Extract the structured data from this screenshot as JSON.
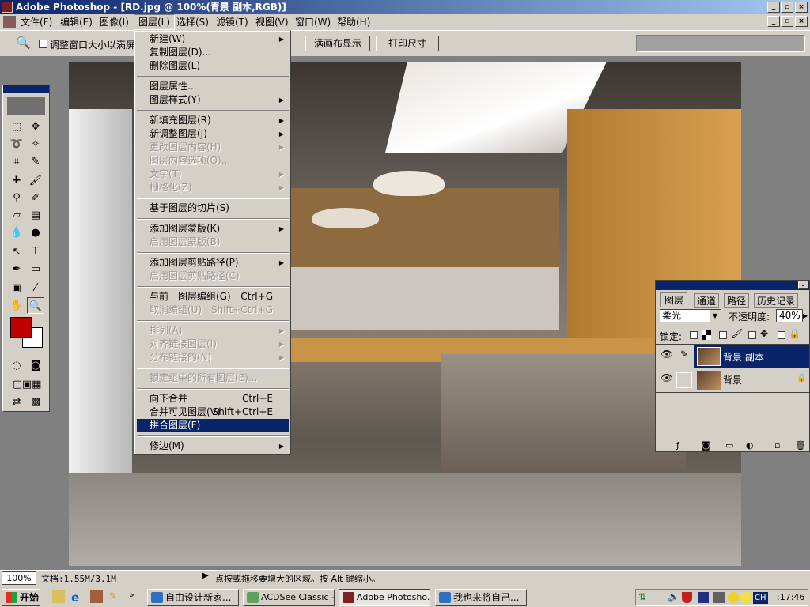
{
  "window": {
    "title": "Adobe Photoshop - [RD.jpg @ 100%(青景 副本,RGB)]"
  },
  "menubar": [
    "文件(F)",
    "编辑(E)",
    "图像(I)",
    "图层(L)",
    "选择(S)",
    "滤镜(T)",
    "视图(V)",
    "窗口(W)",
    "帮助(H)"
  ],
  "options": {
    "checkbox_label": "调整窗口大小以满屏",
    "fit_button": "满画布显示",
    "print_button": "打印尺寸"
  },
  "layer_menu": [
    {
      "label": "新建(W)",
      "sub": true
    },
    {
      "label": "复制图层(D)..."
    },
    {
      "label": "删除图层(L)"
    },
    {
      "sep": true
    },
    {
      "label": "图层属性..."
    },
    {
      "label": "图层样式(Y)",
      "sub": true
    },
    {
      "sep": true
    },
    {
      "label": "新填充图层(R)",
      "sub": true
    },
    {
      "label": "新调整图层(J)",
      "sub": true
    },
    {
      "label": "更改图层内容(H)",
      "sub": true,
      "disabled": true
    },
    {
      "label": "图层内容选项(O)...",
      "disabled": true
    },
    {
      "label": "文字(T)",
      "sub": true,
      "disabled": true
    },
    {
      "label": "栅格化(Z)",
      "sub": true,
      "disabled": true
    },
    {
      "sep": true
    },
    {
      "label": "基于图层的切片(S)"
    },
    {
      "sep": true
    },
    {
      "label": "添加图层蒙版(K)",
      "sub": true
    },
    {
      "label": "启用图层蒙版(B)",
      "disabled": true
    },
    {
      "sep": true
    },
    {
      "label": "添加图层剪贴路径(P)",
      "sub": true
    },
    {
      "label": "启用图层剪贴路径(C)",
      "disabled": true
    },
    {
      "sep": true
    },
    {
      "label": "与前一图层编组(G)",
      "shortcut": "Ctrl+G"
    },
    {
      "label": "取消编组(U)",
      "shortcut": "Shift+Ctrl+G",
      "disabled": true
    },
    {
      "sep": true
    },
    {
      "label": "排列(A)",
      "sub": true,
      "disabled": true
    },
    {
      "label": "对齐链接图层(I)",
      "sub": true,
      "disabled": true
    },
    {
      "label": "分布链接的(N)",
      "sub": true,
      "disabled": true
    },
    {
      "sep": true
    },
    {
      "label": "锁定组中的所有图层(E)...",
      "disabled": true
    },
    {
      "sep": true
    },
    {
      "label": "向下合并",
      "shortcut": "Ctrl+E"
    },
    {
      "label": "合并可见图层(V)",
      "shortcut": "Shift+Ctrl+E"
    },
    {
      "label": "拼合图层(F)",
      "selected": true
    },
    {
      "sep": true
    },
    {
      "label": "修边(M)",
      "sub": true
    }
  ],
  "layers_panel": {
    "tabs": [
      "图层",
      "通道",
      "路径",
      "历史记录"
    ],
    "blend_mode": "柔光",
    "opacity_label": "不透明度:",
    "opacity": "40%",
    "lock_label": "锁定:",
    "layers": [
      {
        "name": "背景 副本",
        "selected": true
      },
      {
        "name": "背景",
        "locked": true
      }
    ]
  },
  "status": {
    "zoom": "100%",
    "doc": "文档:1.55M/3.1M",
    "hint": "点按或拖移要增大的区域。按 Alt 键缩小。"
  },
  "taskbar": {
    "start": "开始",
    "tasks": [
      "自由设计新家...",
      "ACDSee Classic -...",
      "Adobe Photosho...",
      "我也来将自己..."
    ],
    "lang": "CH",
    "clock": ":17:46"
  },
  "colors": {
    "foreground": "#c00000",
    "background": "#ffffff",
    "highlight": "#0a246a"
  }
}
